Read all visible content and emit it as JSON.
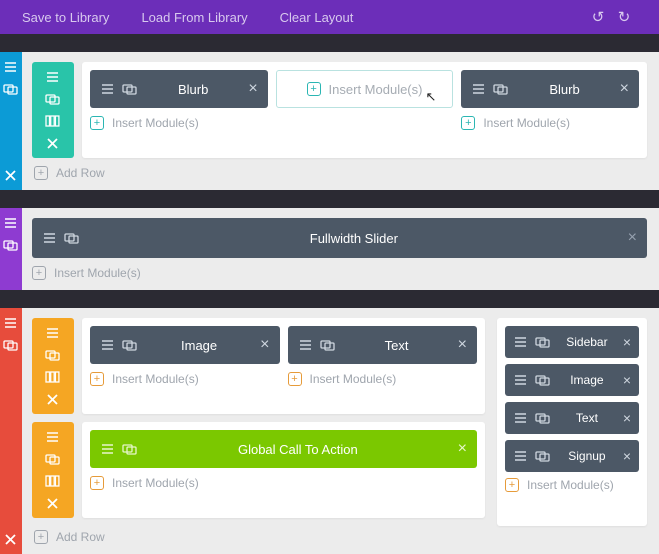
{
  "topbar": {
    "save": "Save to Library",
    "load": "Load From Library",
    "clear": "Clear Layout"
  },
  "labels": {
    "insert_modules": "Insert Module(s)",
    "add_row": "Add Row"
  },
  "section_blue": {
    "row1": {
      "col1_module": "Blurb",
      "col3_module": "Blurb"
    }
  },
  "section_purple": {
    "fullwidth": "Fullwidth Slider"
  },
  "section_red": {
    "row1": {
      "col1_module": "Image",
      "col2_module": "Text"
    },
    "row2": {
      "cta": "Global Call To Action"
    },
    "sidebar": {
      "items": [
        "Sidebar",
        "Image",
        "Text",
        "Signup"
      ]
    }
  },
  "colors": {
    "blue": "#0c9bd6",
    "teal": "#29c4a9",
    "purple": "#8e3bd1",
    "red": "#e74c3c",
    "orange": "#f5a623",
    "green": "#7bc800",
    "dark": "#4c5866"
  }
}
